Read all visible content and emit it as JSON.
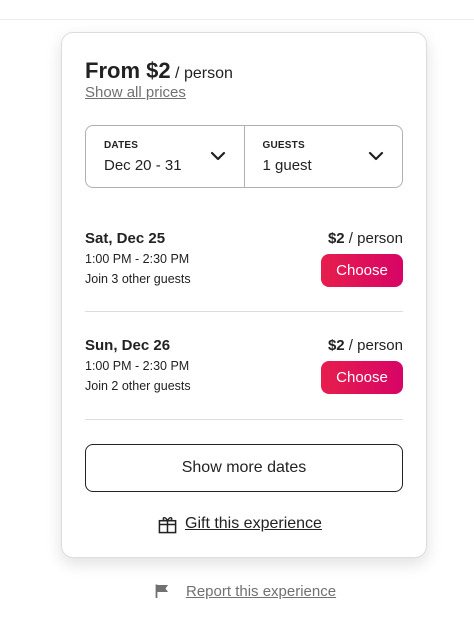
{
  "header": {
    "price_from": "From $2",
    "price_unit": "/ person",
    "show_all_prices": "Show all prices"
  },
  "picker": {
    "dates_label": "DATES",
    "dates_value": "Dec 20 - 31",
    "guests_label": "GUESTS",
    "guests_value": "1 guest"
  },
  "slots": [
    {
      "date": "Sat, Dec 25",
      "time": "1:00 PM - 2:30 PM",
      "join": "Join 3 other guests",
      "price": "$2",
      "unit": "/ person",
      "button": "Choose"
    },
    {
      "date": "Sun, Dec 26",
      "time": "1:00 PM - 2:30 PM",
      "join": "Join 2 other guests",
      "price": "$2",
      "unit": "/ person",
      "button": "Choose"
    }
  ],
  "actions": {
    "show_more_dates": "Show more dates",
    "gift": "Gift this experience",
    "report": "Report this experience"
  },
  "colors": {
    "accent_start": "#e61e4d",
    "accent_end": "#d70466",
    "text": "#222222",
    "muted": "#717171"
  },
  "icons": {
    "dates_dropdown": "chevron-down-icon",
    "guests_dropdown": "chevron-down-icon",
    "gift": "gift-icon",
    "report": "flag-icon"
  }
}
